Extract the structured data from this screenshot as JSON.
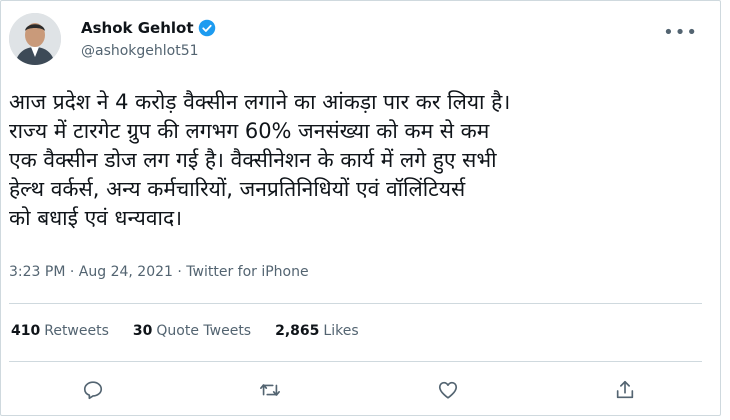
{
  "author": {
    "name": "Ashok Gehlot",
    "handle": "@ashokgehlot51",
    "verified_color": "#1d9bf0"
  },
  "tweet": {
    "text": "आज प्रदेश ने 4 करोड़ वैक्सीन लगाने का आंकड़ा पार कर लिया है।\nराज्य में टारगेट ग्रुप की लगभग 60% जनसंख्या को कम से कम\nएक वैक्सीन डोज लग गई है। वैक्सीनेशन के कार्य में लगे हुए सभी\nहेल्थ वर्कर्स, अन्य कर्मचारियों, जनप्रतिनिधियों एवं वॉलिंटियर्स\nको बधाई एवं धन्यवाद।",
    "time": "3:23 PM",
    "separator": "·",
    "date": "Aug 24, 2021",
    "source": "Twitter for iPhone"
  },
  "stats": {
    "retweets_count": "410",
    "retweets_label": "Retweets",
    "quote_count": "30",
    "quote_label": "Quote Tweets",
    "likes_count": "2,865",
    "likes_label": "Likes"
  },
  "icons": {
    "more": "more-icon",
    "reply": "reply-icon",
    "retweet": "retweet-icon",
    "like": "like-icon",
    "share": "share-icon"
  },
  "colors": {
    "text": "#0f1419",
    "secondary": "#536471",
    "border": "#cfd9de"
  }
}
